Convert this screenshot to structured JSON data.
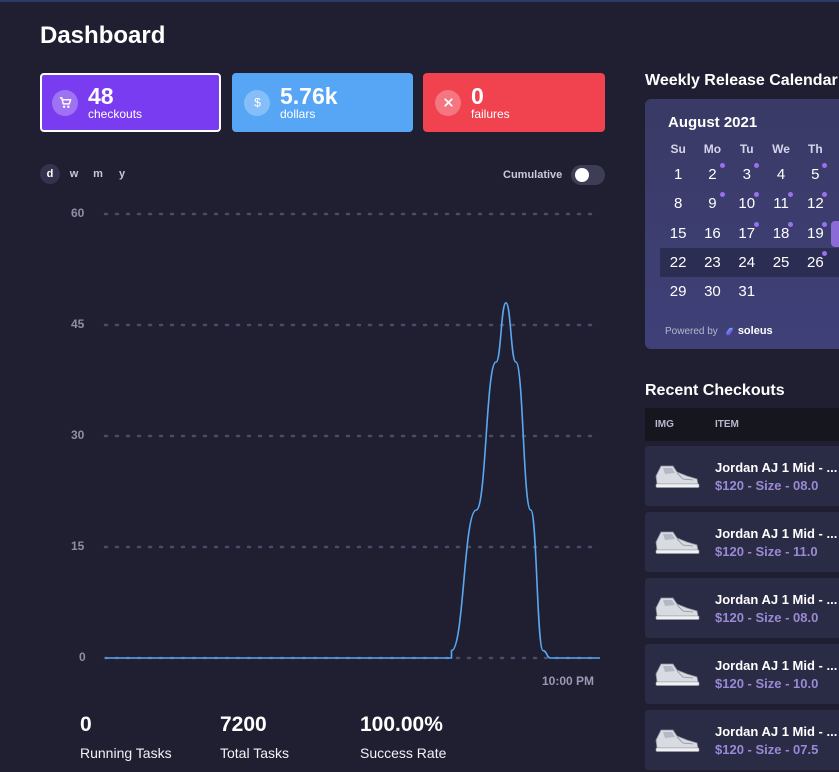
{
  "page": {
    "title": "Dashboard"
  },
  "stats": {
    "checkouts": {
      "value": "48",
      "label": "checkouts",
      "icon": "cart-icon",
      "color": "#7a3cf0"
    },
    "dollars": {
      "value": "5.76k",
      "label": "dollars",
      "icon": "dollar-icon",
      "color": "#56a6f5"
    },
    "failures": {
      "value": "0",
      "label": "failures",
      "icon": "close-icon",
      "color": "#f0424f"
    }
  },
  "range_tabs": [
    "d",
    "w",
    "m",
    "y"
  ],
  "selected_range": "d",
  "cumulative": {
    "label": "Cumulative",
    "enabled": false
  },
  "chart_data": {
    "type": "line",
    "title": "",
    "xlabel": "",
    "ylabel": "",
    "ylim": [
      0,
      60
    ],
    "yticks": [
      "60",
      "45",
      "30",
      "15",
      "0"
    ],
    "xticks": [
      "10:00 PM"
    ],
    "grid": true,
    "series": [
      {
        "color": "#5aa8f2",
        "points": [
          [
            0,
            0
          ],
          [
            0.7,
            0
          ],
          [
            0.7,
            1
          ],
          [
            0.75,
            20
          ],
          [
            0.79,
            40
          ],
          [
            0.81,
            48
          ],
          [
            0.83,
            40
          ],
          [
            0.86,
            20
          ],
          [
            0.885,
            1
          ],
          [
            0.9,
            0
          ],
          [
            1,
            0
          ]
        ]
      }
    ]
  },
  "bottom_stats": [
    {
      "value": "0",
      "label": "Running Tasks"
    },
    {
      "value": "7200",
      "label": "Total Tasks"
    },
    {
      "value": "100.00%",
      "label": "Success Rate"
    }
  ],
  "calendar": {
    "section_title": "Weekly Release Calendar",
    "month": "August 2021",
    "weekdays": [
      "Su",
      "Mo",
      "Tu",
      "We",
      "Th"
    ],
    "weeks": [
      [
        {
          "d": "1",
          "dot": false
        },
        {
          "d": "2",
          "dot": true
        },
        {
          "d": "3",
          "dot": true
        },
        {
          "d": "4",
          "dot": false
        },
        {
          "d": "5",
          "dot": true
        }
      ],
      [
        {
          "d": "8",
          "dot": false
        },
        {
          "d": "9",
          "dot": true
        },
        {
          "d": "10",
          "dot": true
        },
        {
          "d": "11",
          "dot": true
        },
        {
          "d": "12",
          "dot": true
        }
      ],
      [
        {
          "d": "15",
          "dot": false
        },
        {
          "d": "16",
          "dot": false
        },
        {
          "d": "17",
          "dot": true
        },
        {
          "d": "18",
          "dot": true
        },
        {
          "d": "19",
          "dot": true
        }
      ],
      [
        {
          "d": "22",
          "dot": false
        },
        {
          "d": "23",
          "dot": false
        },
        {
          "d": "24",
          "dot": false
        },
        {
          "d": "25",
          "dot": false
        },
        {
          "d": "26",
          "dot": true
        }
      ],
      [
        {
          "d": "29",
          "dot": false
        },
        {
          "d": "30",
          "dot": false
        },
        {
          "d": "31",
          "dot": false
        }
      ]
    ],
    "highlight_week": 3,
    "powered_by": "Powered by",
    "brand": "soleus"
  },
  "recent_checkouts": {
    "section_title": "Recent Checkouts",
    "columns": [
      "IMG",
      "ITEM"
    ],
    "rows": [
      {
        "name": "Jordan AJ 1 Mid - ...",
        "detail": "$120 - Size - 08.0"
      },
      {
        "name": "Jordan AJ 1 Mid - ...",
        "detail": "$120 - Size - 11.0"
      },
      {
        "name": "Jordan AJ 1 Mid - ...",
        "detail": "$120 - Size - 08.0"
      },
      {
        "name": "Jordan AJ 1 Mid - ...",
        "detail": "$120 - Size - 10.0"
      },
      {
        "name": "Jordan AJ 1 Mid - ...",
        "detail": "$120 - Size - 07.5"
      }
    ]
  }
}
